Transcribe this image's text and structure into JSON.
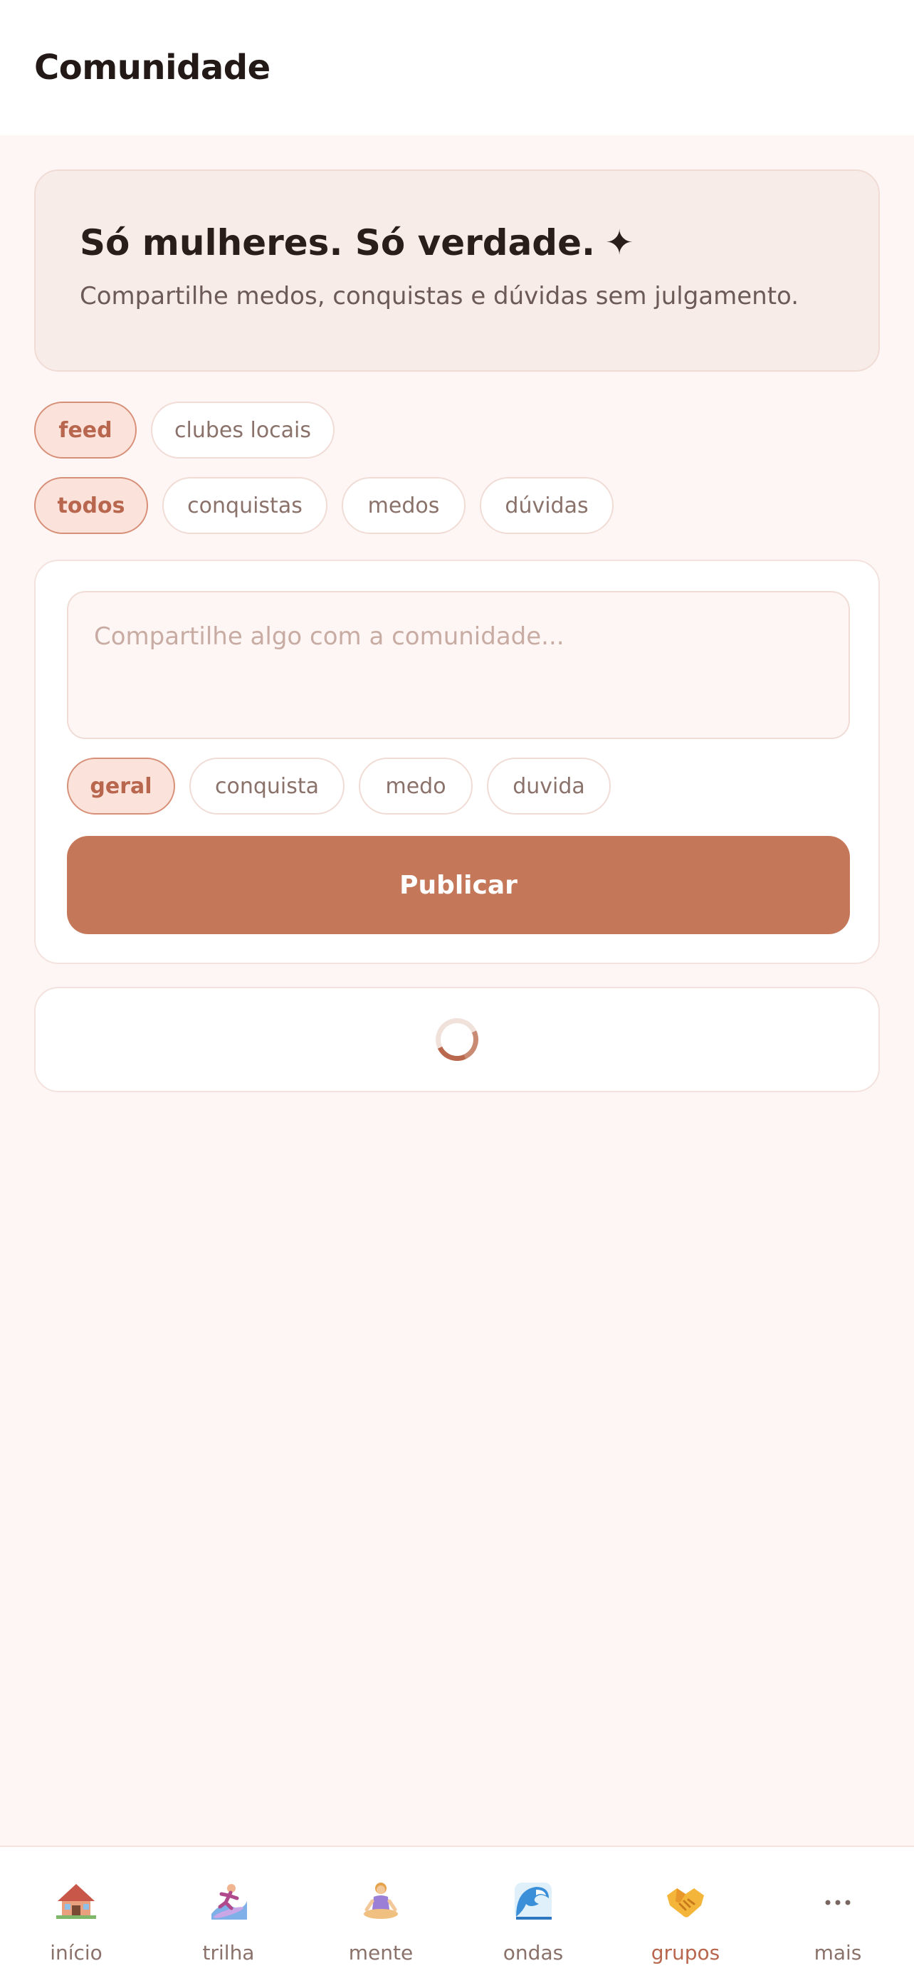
{
  "header": {
    "title": "Comunidade"
  },
  "hero": {
    "title": "Só mulheres. Só verdade.",
    "sparkle": "✦",
    "subtitle": "Compartilhe medos, conquistas e dúvidas sem julgamento."
  },
  "view_tabs": [
    {
      "label": "feed",
      "active": true
    },
    {
      "label": "clubes locais",
      "active": false
    }
  ],
  "filters": [
    {
      "label": "todos",
      "active": true
    },
    {
      "label": "conquistas",
      "active": false
    },
    {
      "label": "medos",
      "active": false
    },
    {
      "label": "dúvidas",
      "active": false
    }
  ],
  "composer": {
    "placeholder": "Compartilhe algo com a comunidade...",
    "value": "",
    "categories": [
      {
        "label": "geral",
        "active": true
      },
      {
        "label": "conquista",
        "active": false
      },
      {
        "label": "medo",
        "active": false
      },
      {
        "label": "duvida",
        "active": false
      }
    ],
    "publish_label": "Publicar"
  },
  "nav": {
    "items": [
      {
        "label": "início",
        "icon": "house-icon"
      },
      {
        "label": "trilha",
        "icon": "surfer-icon"
      },
      {
        "label": "mente",
        "icon": "meditation-icon"
      },
      {
        "label": "ondas",
        "icon": "wave-icon"
      },
      {
        "label": "grupos",
        "icon": "handshake-icon",
        "active": true
      },
      {
        "label": "mais",
        "icon": "more-icon"
      }
    ]
  },
  "colors": {
    "accent": "#c47859",
    "background": "#fdf6f4",
    "hero_bg": "#f8ece8",
    "pill_active_bg": "#fbe3dc"
  }
}
